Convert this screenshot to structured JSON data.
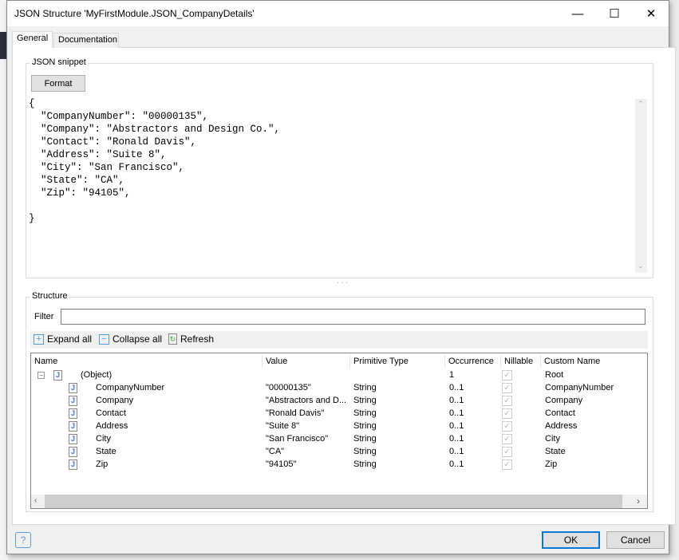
{
  "window": {
    "title": "JSON Structure 'MyFirstModule.JSON_CompanyDetails'",
    "minimize": "—",
    "maximize": "☐",
    "close": "✕"
  },
  "tabs": [
    {
      "label": "General",
      "active": true
    },
    {
      "label": "Documentation",
      "active": false
    }
  ],
  "snippet": {
    "label": "JSON snippet",
    "format_label": "Format",
    "lines": [
      "{",
      "  \"CompanyNumber\": \"00000135\",",
      "  \"Company\": \"Abstractors and Design Co.\",",
      "  \"Contact\": \"Ronald Davis\",",
      "  \"Address\": \"Suite 8\",",
      "  \"City\": \"San Francisco\",",
      "  \"State\": \"CA\",",
      "  \"Zip\": \"94105\",",
      "",
      "}"
    ]
  },
  "splitter": "· · ·",
  "structure": {
    "label": "Structure",
    "filter_label": "Filter",
    "filter_value": "",
    "toolbar": {
      "expand": "Expand all",
      "collapse": "Collapse all",
      "refresh": "Refresh"
    },
    "columns": [
      "Name",
      "Value",
      "Primitive Type",
      "Occurrence",
      "Nillable",
      "Custom Name"
    ],
    "rows": [
      {
        "name": "(Object)",
        "value": "",
        "type": "",
        "occ": "1",
        "nillable": true,
        "custom": "Root",
        "level": 0
      },
      {
        "name": "CompanyNumber",
        "value": "\"00000135\"",
        "type": "String",
        "occ": "0..1",
        "nillable": true,
        "custom": "CompanyNumber",
        "level": 1
      },
      {
        "name": "Company",
        "value": "\"Abstractors and D...",
        "type": "String",
        "occ": "0..1",
        "nillable": true,
        "custom": "Company",
        "level": 1
      },
      {
        "name": "Contact",
        "value": "\"Ronald Davis\"",
        "type": "String",
        "occ": "0..1",
        "nillable": true,
        "custom": "Contact",
        "level": 1
      },
      {
        "name": "Address",
        "value": "\"Suite 8\"",
        "type": "String",
        "occ": "0..1",
        "nillable": true,
        "custom": "Address",
        "level": 1
      },
      {
        "name": "City",
        "value": "\"San Francisco\"",
        "type": "String",
        "occ": "0..1",
        "nillable": true,
        "custom": "City",
        "level": 1
      },
      {
        "name": "State",
        "value": "\"CA\"",
        "type": "String",
        "occ": "0..1",
        "nillable": true,
        "custom": "State",
        "level": 1
      },
      {
        "name": "Zip",
        "value": "\"94105\"",
        "type": "String",
        "occ": "0..1",
        "nillable": true,
        "custom": "Zip",
        "level": 1
      }
    ]
  },
  "footer": {
    "help": "?",
    "ok": "OK",
    "cancel": "Cancel"
  },
  "colors": {
    "accent": "#0078d7",
    "icon_blue": "#3a7bd5"
  }
}
